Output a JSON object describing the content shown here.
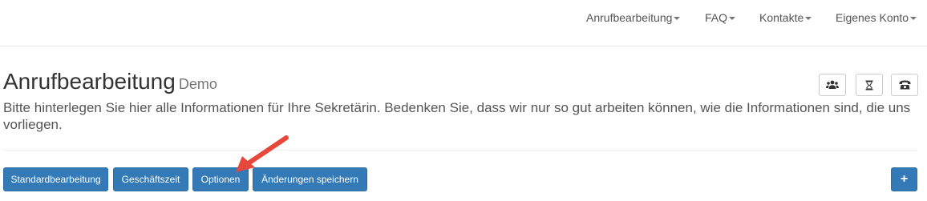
{
  "nav": {
    "items": [
      {
        "label": "Anrufbearbeitung"
      },
      {
        "label": "FAQ"
      },
      {
        "label": "Kontakte"
      },
      {
        "label": "Eigenes Konto"
      }
    ]
  },
  "header": {
    "title": "Anrufbearbeitung",
    "subtitle": "Demo",
    "description": "Bitte hinterlegen Sie hier alle Informationen für Ihre Sekretärin. Bedenken Sie, dass wir nur so gut arbeiten können, wie die Informationen sind, die uns vorliegen."
  },
  "toolbar": {
    "icons": [
      "users-icon",
      "hourglass-icon",
      "phone-icon"
    ]
  },
  "buttons": {
    "standard": "Standardbearbeitung",
    "business_hours": "Geschäftszeit",
    "options": "Optionen",
    "save": "Änderungen speichern",
    "add": "+"
  },
  "colors": {
    "primary": "#337ab7",
    "primary_border": "#2e6da4",
    "arrow": "#e8473b"
  }
}
